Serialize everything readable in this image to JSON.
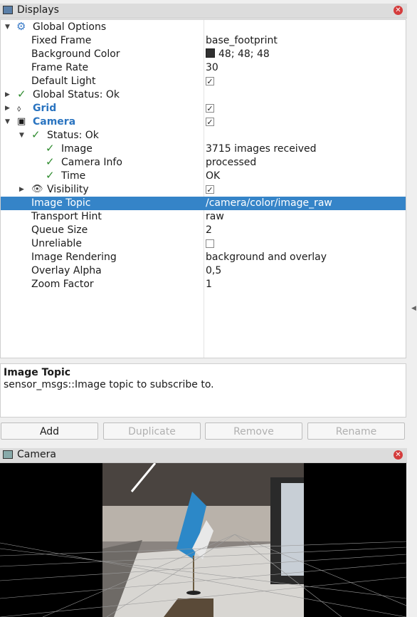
{
  "displays_panel": {
    "title": "Displays",
    "rows": [
      {
        "name": "Global Options",
        "value": ""
      },
      {
        "name": "Fixed Frame",
        "value": "base_footprint"
      },
      {
        "name": "Background Color",
        "value": "48; 48; 48"
      },
      {
        "name": "Frame Rate",
        "value": "30"
      },
      {
        "name": "Default Light",
        "value": ""
      },
      {
        "name": "Global Status: Ok",
        "value": ""
      },
      {
        "name": "Grid",
        "value": ""
      },
      {
        "name": "Camera",
        "value": ""
      },
      {
        "name": "Status: Ok",
        "value": ""
      },
      {
        "name": "Image",
        "value": "3715 images received"
      },
      {
        "name": "Camera Info",
        "value": "processed"
      },
      {
        "name": "Time",
        "value": "OK"
      },
      {
        "name": "Visibility",
        "value": ""
      },
      {
        "name": "Image Topic",
        "value": "/camera/color/image_raw"
      },
      {
        "name": "Transport Hint",
        "value": "raw"
      },
      {
        "name": "Queue Size",
        "value": "2"
      },
      {
        "name": "Unreliable",
        "value": ""
      },
      {
        "name": "Image Rendering",
        "value": "background and overlay"
      },
      {
        "name": "Overlay Alpha",
        "value": "0,5"
      },
      {
        "name": "Zoom Factor",
        "value": "1"
      }
    ]
  },
  "description": {
    "title": "Image Topic",
    "text": "sensor_msgs::Image topic to subscribe to."
  },
  "buttons": {
    "add": "Add",
    "duplicate": "Duplicate",
    "remove": "Remove",
    "rename": "Rename"
  },
  "camera_panel": {
    "title": "Camera"
  },
  "colors": {
    "selection": "#3584c8",
    "link_blue": "#2a74c0",
    "ok_green": "#2e8b2e",
    "background_swatch": "#303030"
  }
}
